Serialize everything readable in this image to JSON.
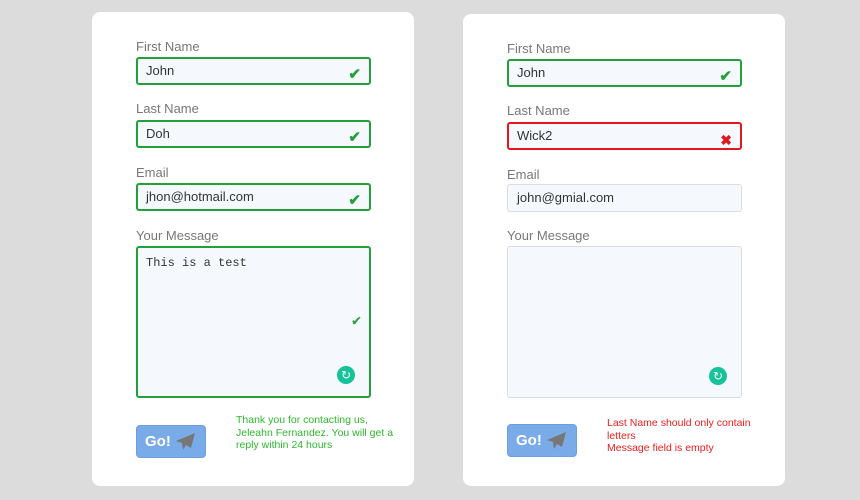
{
  "labels": {
    "first": "First Name",
    "last": "Last Name",
    "email": "Email",
    "message": "Your Message"
  },
  "left": {
    "first": "John",
    "last": "Doh",
    "email": "jhon@hotmail.com",
    "message": "This is a test",
    "button": "Go!",
    "status": "Thank you for contacting us, Jeleahn Fernandez. You will get a reply within 24 hours"
  },
  "right": {
    "first": "John",
    "last": "Wick2",
    "email": "john@gmial.com",
    "message": "",
    "button": "Go!",
    "errors": [
      "Last Name should only contain letters",
      "Message field is empty"
    ]
  },
  "colors": {
    "valid": "#23a03a",
    "invalid": "#e0191f",
    "button": "#7aabe9"
  }
}
